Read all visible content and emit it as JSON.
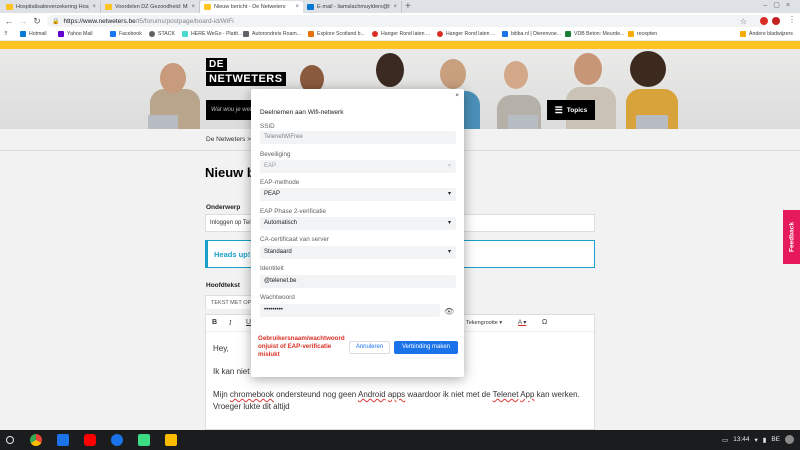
{
  "browser": {
    "tabs": [
      {
        "title": "Hospitalisatieverzekering Hosp",
        "favicon_color": "#ffc421",
        "active": false
      },
      {
        "title": "Voordelen DZ Gezondheid: Min",
        "favicon_color": "#ffc421",
        "active": false
      },
      {
        "title": "Nieuw bericht - De Netweters",
        "favicon_color": "#ffc421",
        "active": true
      },
      {
        "title": "E-mail - liamslachmuylders@h",
        "favicon_color": "#0078d4",
        "active": false
      }
    ],
    "new_tab": "+",
    "url_host": "https://www.netweters.be",
    "url_path": "/t5/forums/postpage/board-id/WiFi",
    "bookmarks": [
      {
        "label": "Hotmail",
        "color": "#0078d4"
      },
      {
        "label": "Yahoo Mail",
        "color": "#6001d2"
      },
      {
        "label": "Facebook",
        "color": "#1877f2"
      },
      {
        "label": "STACK",
        "color": "#5f6368"
      },
      {
        "label": "HERE WeGo - Plattt...",
        "color": "#48dad0"
      },
      {
        "label": "Autorondreis Roam...",
        "color": "#5f6368"
      },
      {
        "label": "Explore Scotland b...",
        "color": "#e8710a"
      },
      {
        "label": "Hanger Rond laten ...",
        "color": "#d93025"
      },
      {
        "label": "Hanger Rond laten ...",
        "color": "#d93025"
      },
      {
        "label": "bitiba.nl | Dierenvoe...",
        "color": "#1a73e8"
      },
      {
        "label": "VDB Beton: Meurde...",
        "color": "#188038"
      },
      {
        "label": "recepten",
        "color": "#f9ab00"
      }
    ],
    "other_bookmarks": "Andere bladwijzers"
  },
  "site": {
    "logo_line1": "DE",
    "logo_line2": "NETWETERS",
    "search_placeholder": "Wat wou je wet",
    "topics_label": "Topics",
    "breadcrumb": "De Netweters  >",
    "page_title": "Nieuw b",
    "subject_label": "Onderwerp",
    "subject_value": "Inloggen op Tel",
    "alert_text": "Heads up!",
    "body_label": "Hoofdtekst",
    "editor_tab": "TEKST MET OP",
    "toolbar": {
      "bold": "B",
      "italic": "I",
      "underline": "U",
      "fontsize": "Tekengrootte ▾",
      "color": "A ▾",
      "omega": "Ω"
    },
    "editor_text": {
      "p1": "Hey,",
      "p2_start": "Ik kan niet r",
      "p3_a": "Mijn ",
      "p3_chromebook": "chromebook",
      "p3_b": " ondersteund nog geen ",
      "p3_android": "Android",
      "p3_c": " ",
      "p3_apps": "apps",
      "p3_d": " waardoor ik niet met de ",
      "p3_telenet": "Telenet",
      "p3_e": " ",
      "p3_app": "App",
      "p3_f": " kan werken.",
      "p4": "Vroeger lukte dit altijd"
    },
    "feedback": "Feedback"
  },
  "dialog": {
    "title": "Deelnemen aan Wifi-netwerk",
    "close": "×",
    "ssid_label": "SSID",
    "ssid_value": "TelenetWiFree",
    "security_label": "Beveiliging",
    "security_value": "EAP",
    "eap_method_label": "EAP-methode",
    "eap_method_value": "PEAP",
    "phase2_label": "EAP Phase 2-verificatie",
    "phase2_value": "Automatisch",
    "ca_label": "CA-certificaat van server",
    "ca_value": "Standaard",
    "identity_label": "Identiteit",
    "identity_value": "@telenet.be",
    "password_label": "Wachtwoord",
    "password_value": "•••••••••",
    "error": "Gebruikersnaam/wachtwoord onjuist of EAP-verificatie mislukt",
    "cancel": "Annuleren",
    "connect": "Verbinding maken"
  },
  "shelf": {
    "time": "13:44",
    "locale": "BE",
    "apps": [
      {
        "name": "chrome",
        "color": "#4285f4"
      },
      {
        "name": "files",
        "color": "#1a73e8"
      },
      {
        "name": "youtube",
        "color": "#ff0000"
      },
      {
        "name": "settings",
        "color": "#1a73e8"
      },
      {
        "name": "android-app",
        "color": "#3ddc84"
      },
      {
        "name": "keep",
        "color": "#fbbc04"
      }
    ]
  }
}
